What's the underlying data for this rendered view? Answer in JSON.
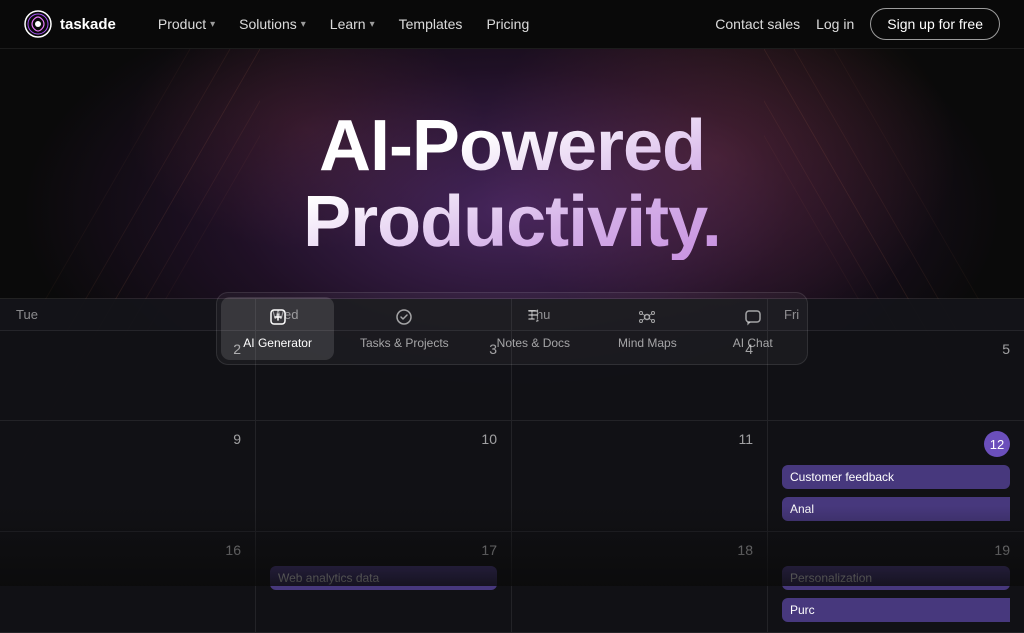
{
  "brand": {
    "name": "taskade",
    "logo_alt": "Taskade logo"
  },
  "nav": {
    "product_label": "Product",
    "solutions_label": "Solutions",
    "learn_label": "Learn",
    "templates_label": "Templates",
    "pricing_label": "Pricing",
    "contact_sales_label": "Contact sales",
    "login_label": "Log in",
    "signup_label": "Sign up for free"
  },
  "hero": {
    "headline_line1": "AI-Powered",
    "headline_line2": "Productivity."
  },
  "tabs": [
    {
      "id": "ai-generator",
      "icon": "🤖",
      "label": "AI Generator",
      "active": true
    },
    {
      "id": "tasks-projects",
      "icon": "✅",
      "label": "Tasks & Projects",
      "active": false
    },
    {
      "id": "notes-docs",
      "icon": "✏️",
      "label": "Notes & Docs",
      "active": false
    },
    {
      "id": "mind-maps",
      "icon": "⚙️",
      "label": "Mind Maps",
      "active": false
    },
    {
      "id": "ai-chat",
      "icon": "💬",
      "label": "AI Chat",
      "active": false
    }
  ],
  "calendar": {
    "days": [
      "Tue",
      "Wed",
      "Thu",
      "Fri"
    ],
    "rows": [
      {
        "cells": [
          {
            "date": "2",
            "events": []
          },
          {
            "date": "3",
            "events": []
          },
          {
            "date": "4",
            "events": []
          },
          {
            "date": "5",
            "events": []
          }
        ]
      },
      {
        "cells": [
          {
            "date": "9",
            "events": []
          },
          {
            "date": "10",
            "events": []
          },
          {
            "date": "11",
            "events": []
          },
          {
            "date": "12",
            "today": true,
            "events": [
              {
                "label": "Customer feedback",
                "partial": false
              },
              {
                "label": "Anal",
                "partial": true
              }
            ]
          }
        ]
      },
      {
        "cells": [
          {
            "date": "16",
            "events": []
          },
          {
            "date": "17",
            "events": [
              {
                "label": "Web analytics data",
                "partial": false
              }
            ]
          },
          {
            "date": "18",
            "events": []
          },
          {
            "date": "19",
            "events": [
              {
                "label": "Personalization",
                "partial": false
              },
              {
                "label": "Purc",
                "partial": true
              }
            ]
          }
        ]
      }
    ]
  }
}
